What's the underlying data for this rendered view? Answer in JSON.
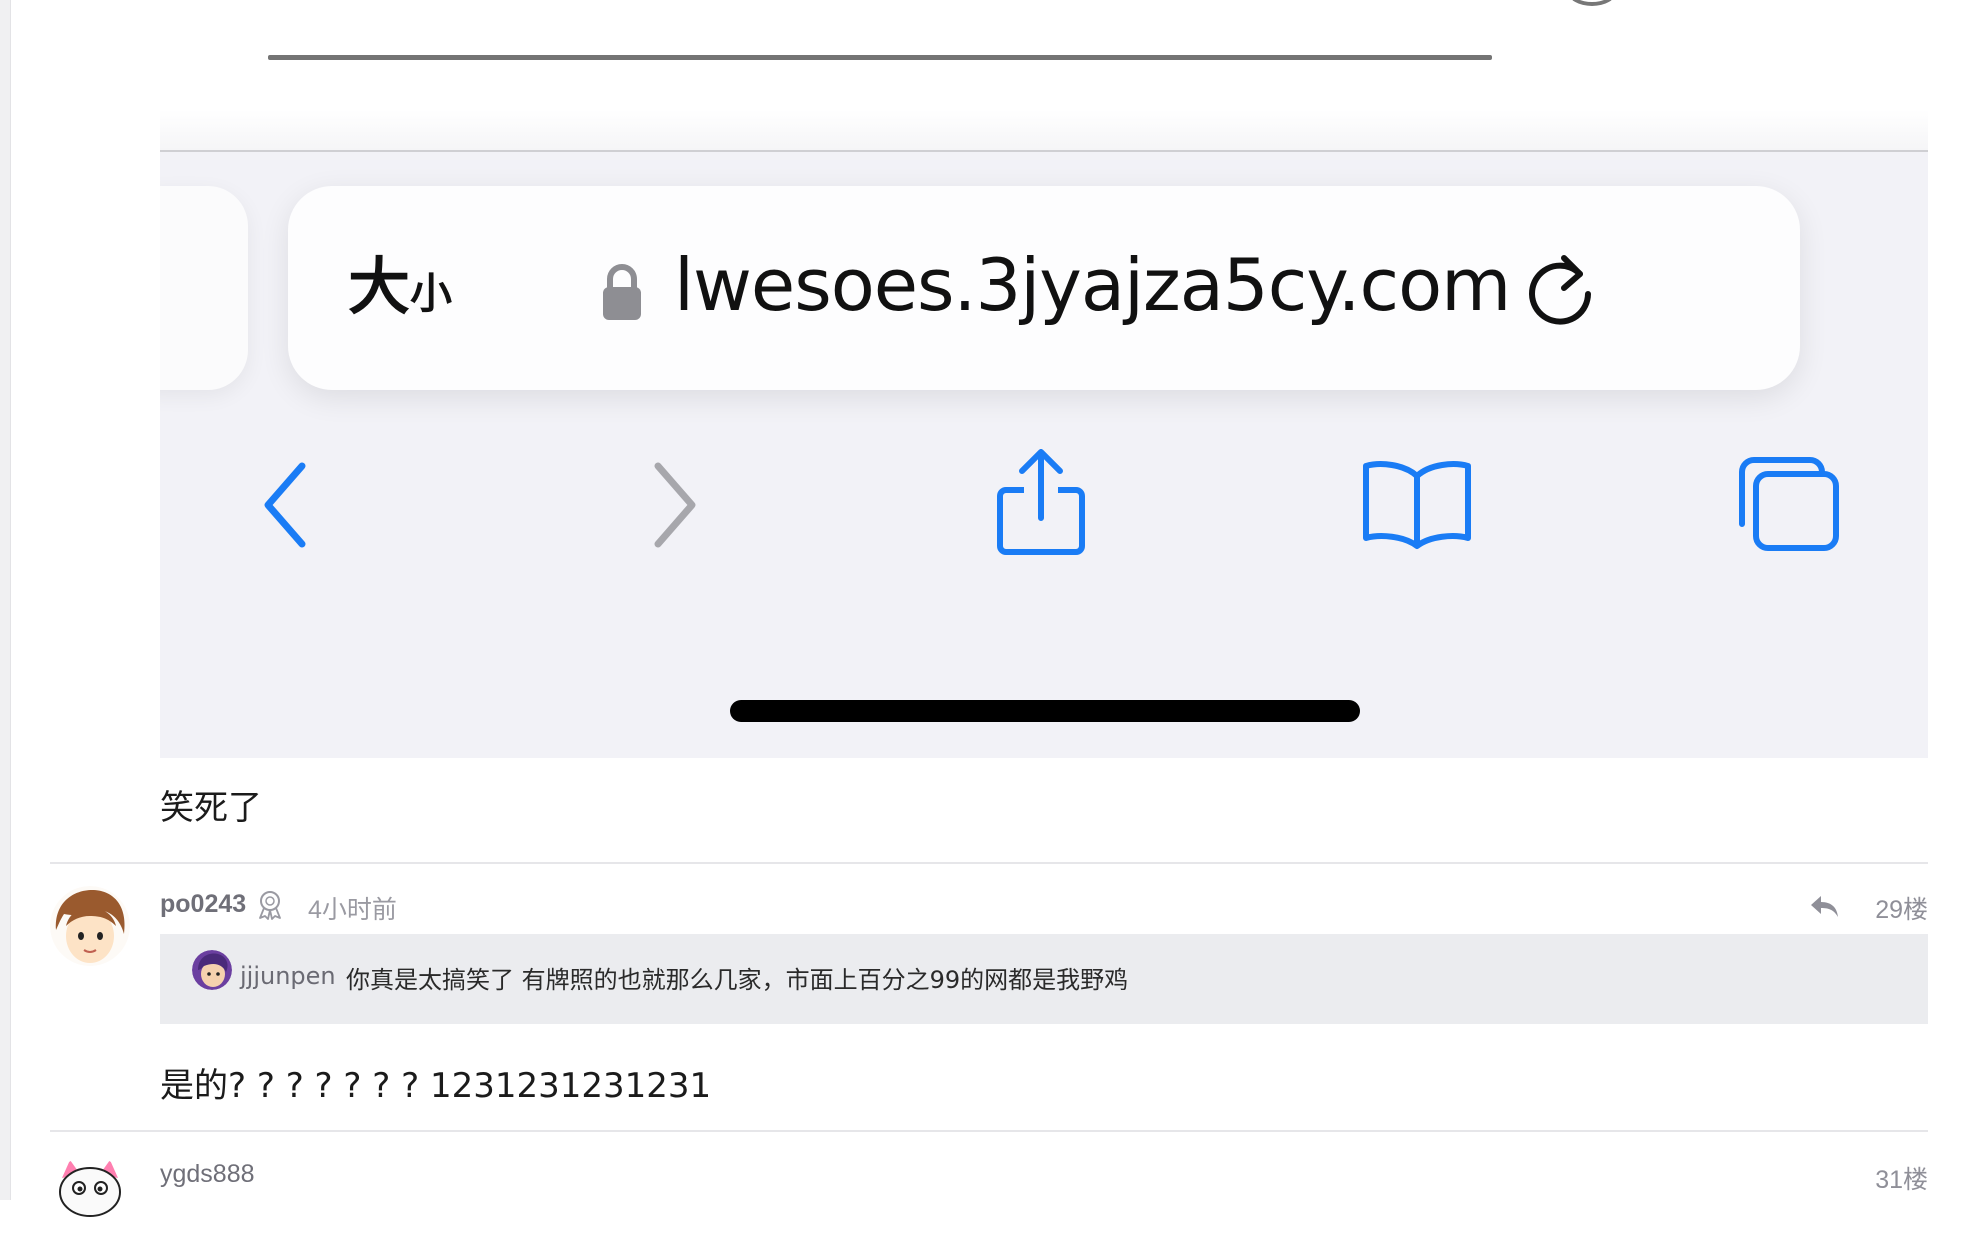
{
  "embedded_screenshot": {
    "text_size_label_big": "大",
    "text_size_label_small": "小",
    "url": "lwesoes.3jyajza5cy.com",
    "icons": [
      "back-icon",
      "forward-icon",
      "share-icon",
      "bookmarks-icon",
      "tabs-icon",
      "reload-icon",
      "lock-icon"
    ],
    "accent_color": "#1a7cf5"
  },
  "posts": [
    {
      "body": "笑死了"
    },
    {
      "user": "po0243",
      "badge_icon": "award-icon",
      "time": "4小时前",
      "floor": "29楼",
      "quote": {
        "user": "jjjunpen",
        "text": "你真是太搞笑了 有牌照的也就那么几家，市面上百分之99的网都是我野鸡"
      },
      "body": "是的? ? ? ? ? ? ? 1231231231231"
    },
    {
      "user": "ygds888",
      "floor": "31楼"
    }
  ]
}
